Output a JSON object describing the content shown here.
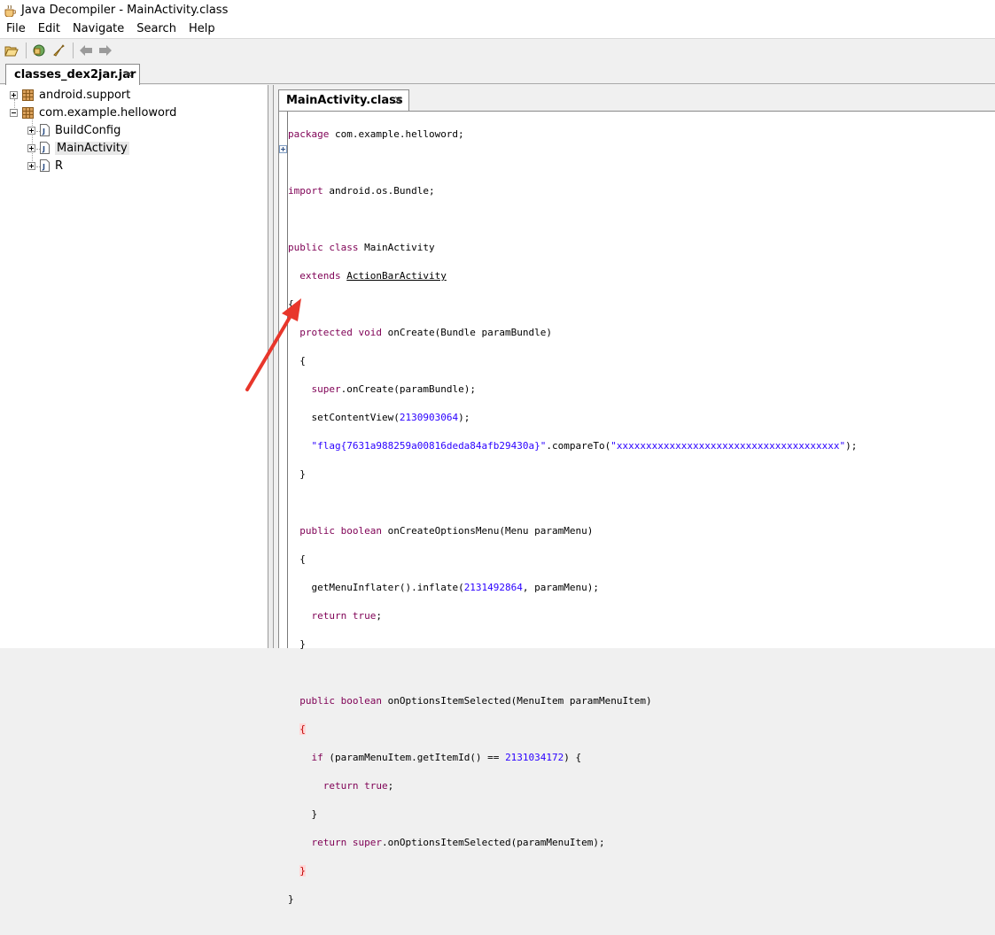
{
  "window": {
    "title": "Java Decompiler - MainActivity.class"
  },
  "menu": [
    "File",
    "Edit",
    "Navigate",
    "Search",
    "Help"
  ],
  "toolbar": {
    "buttons": [
      "open-file-icon",
      "open-type-icon",
      "search-icon",
      "back-icon",
      "forward-icon"
    ]
  },
  "outer_tab": {
    "label": "classes_dex2jar.jar",
    "close": "×"
  },
  "tree": {
    "items": [
      {
        "label": "android.support"
      },
      {
        "label": "com.example.helloword"
      },
      {
        "label": "BuildConfig"
      },
      {
        "label": "MainActivity"
      },
      {
        "label": "R"
      }
    ]
  },
  "editor_tab": {
    "label": "MainActivity.class",
    "close": "×"
  },
  "code": {
    "package_kw": "package",
    "package_name": " com.example.helloword;",
    "import_kw": "import",
    "import_name": " android.os.Bundle;",
    "class_kw": "public class",
    "class_name": " MainActivity",
    "extends_kw": "extends",
    "super_class": "ActionBarActivity",
    "m1_kw": "protected void",
    "m1_sig": " onCreate(Bundle paramBundle)",
    "m1_super_kw": "super",
    "m1_super_rest": ".onCreate(paramBundle);",
    "m1_scv_pre": "setContentView(",
    "m1_scv_num": "2130903064",
    "m1_scv_post": ");",
    "m1_flag_str": "\"flag{7631a988259a00816deda84afb29430a}\"",
    "m1_compare": ".compareTo(",
    "m1_x_str": "\"xxxxxxxxxxxxxxxxxxxxxxxxxxxxxxxxxxxxxx\"",
    "m1_end": ");",
    "m2_kw": "public boolean",
    "m2_sig": " onCreateOptionsMenu(Menu paramMenu)",
    "m2_inflate_pre": "getMenuInflater().inflate(",
    "m2_inflate_num": "2131492864",
    "m2_inflate_post": ", paramMenu);",
    "m2_return_kw": "return true",
    "m3_kw": "public boolean",
    "m3_sig": " onOptionsItemSelected(MenuItem paramMenuItem)",
    "m3_if_kw": "if",
    "m3_if_cond": " (paramMenuItem.getItemId() == ",
    "m3_if_num": "2131034172",
    "m3_if_post": ") {",
    "m3_return_true": "return true",
    "m3_return_super_kw": "return super",
    "m3_return_super_rest": ".onOptionsItemSelected(paramMenuItem);",
    "open_brace": "{",
    "close_brace": "}",
    "semicolon": ";"
  }
}
